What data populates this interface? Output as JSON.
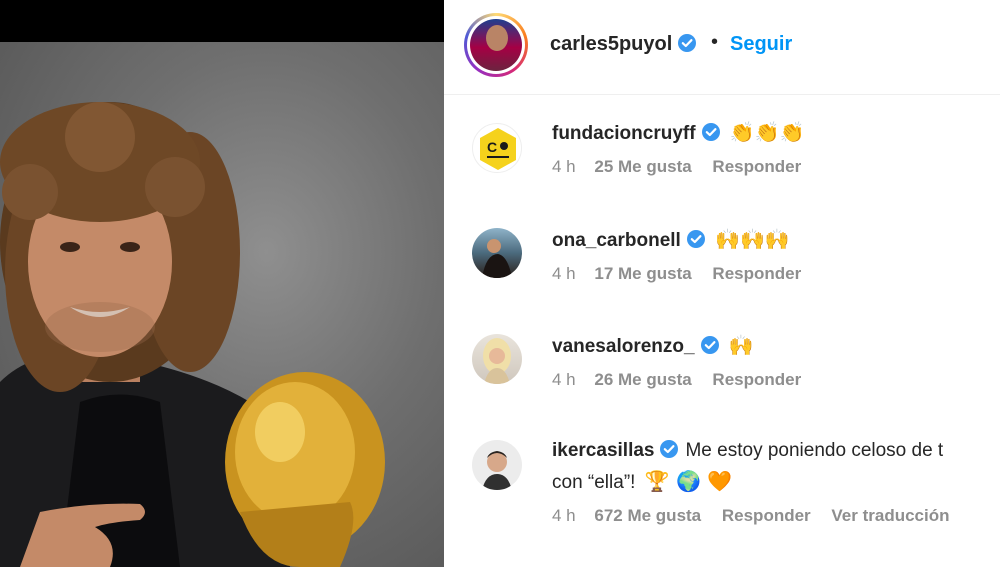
{
  "post": {
    "author": "carles5puyol",
    "follow_label": "Seguir",
    "separator": "•"
  },
  "comments": [
    {
      "username": "fundacioncruyff",
      "text": "",
      "emoji": "👏👏👏",
      "time": "4 h",
      "likes": "25 Me gusta",
      "reply": "Responder"
    },
    {
      "username": "ona_carbonell",
      "text": "",
      "emoji": "🙌🙌🙌",
      "time": "4 h",
      "likes": "17 Me gusta",
      "reply": "Responder"
    },
    {
      "username": "vanesalorenzo_",
      "text": "",
      "emoji": "🙌",
      "time": "4 h",
      "likes": "26 Me gusta",
      "reply": "Responder"
    },
    {
      "username": "ikercasillas",
      "text": "Me estoy poniendo celoso de t",
      "text_line2": "con “ella”!",
      "emoji": "🏆 🌍 🧡",
      "time": "4 h",
      "likes": "672 Me gusta",
      "reply": "Responder",
      "translate": "Ver traducción"
    }
  ],
  "colors": {
    "link_blue": "#0095f6",
    "verified_blue": "#3897f0",
    "meta_gray": "#8e8e8e"
  }
}
